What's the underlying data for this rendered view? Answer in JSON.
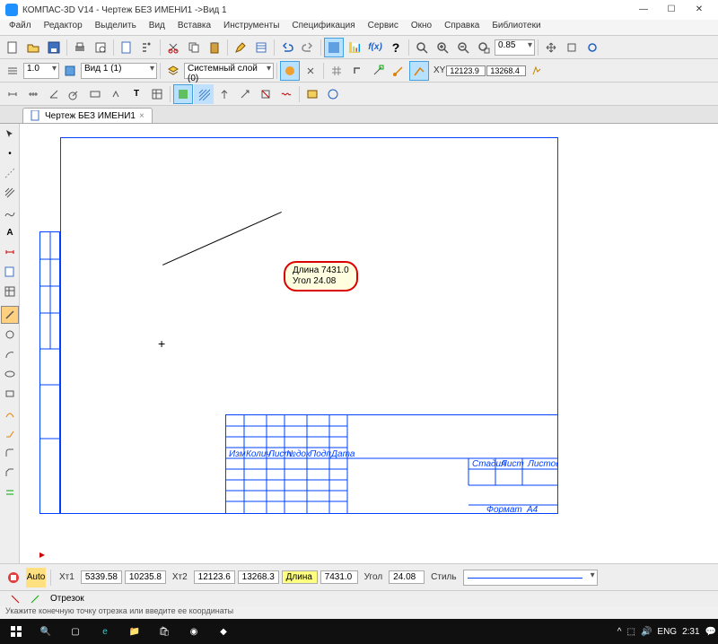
{
  "window": {
    "title": "КОМПАС-3D V14 - Чертеж БЕЗ ИМЕНИ1 ->Вид 1"
  },
  "menu": [
    "Файл",
    "Редактор",
    "Выделить",
    "Вид",
    "Вставка",
    "Инструменты",
    "Спецификация",
    "Сервис",
    "Окно",
    "Справка",
    "Библиотеки"
  ],
  "tb1": {
    "zoom": "0.85"
  },
  "tb2": {
    "scale": "1.0",
    "view": "Вид 1 (1)",
    "layer": "Системный слой (0)",
    "x": "12123.9",
    "y": "13268.4"
  },
  "tab": {
    "name": "Чертеж БЕЗ ИМЕНИ1",
    "close": "×"
  },
  "tooltip": {
    "l1": "Длина 7431.0",
    "l2": "Угол  24.08"
  },
  "title_block": {
    "format": "Формат",
    "a4": "A4",
    "stage": "Стадия",
    "sheet": "Лист",
    "sheets": "Листов",
    "h1": "Изм",
    "h2": "Колич",
    "h3": "Лист",
    "h4": "№док",
    "h5": "Подп",
    "h6": "Дата"
  },
  "prop": {
    "lbl_t1": "т1",
    "x1": "5339.58",
    "y1": "10235.8",
    "lbl_t2": "т2",
    "x2": "12123.6",
    "y2": "13268.3",
    "len_lbl": "Длина",
    "len": "7431.0",
    "ang_lbl": "Угол",
    "ang": "24.08",
    "style_lbl": "Стиль"
  },
  "prop_mode": "Отрезок",
  "status": "Укажите конечную точку отрезка или введите ее координаты",
  "tray": {
    "lang": "ENG",
    "time": "2:31"
  }
}
